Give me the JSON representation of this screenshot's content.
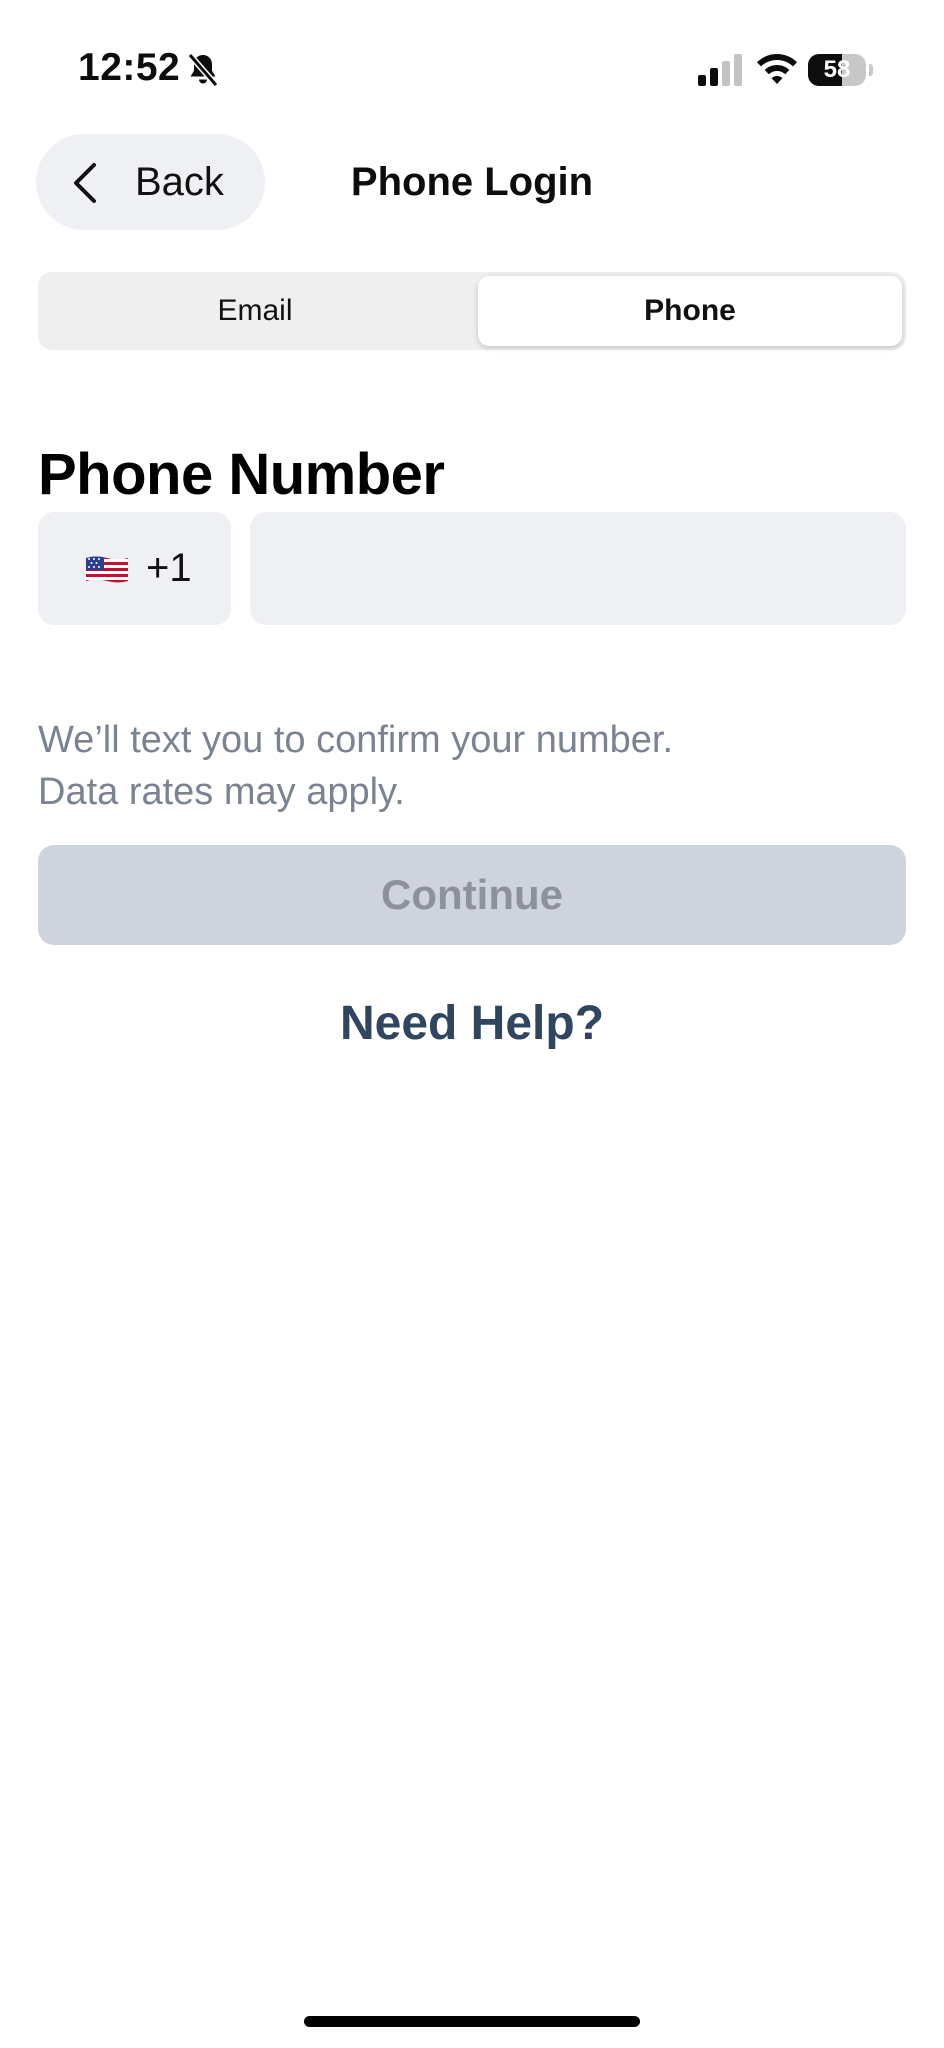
{
  "status_bar": {
    "time": "12:52",
    "battery_percent": "58",
    "battery_level": 0.58,
    "icons": [
      "bell-slash-icon",
      "cellular-signal-icon",
      "wifi-icon",
      "battery-icon"
    ]
  },
  "header": {
    "back_label": "Back",
    "title": "Phone Login"
  },
  "tabs": [
    {
      "label": "Email",
      "selected": false
    },
    {
      "label": "Phone",
      "selected": true
    }
  ],
  "phone_form": {
    "heading": "Phone Number",
    "country_flag": "us-flag-icon",
    "country_code": "+1",
    "phone_value": "",
    "helper_lines": [
      "We’ll text you to confirm your number.",
      "Data rates may apply."
    ],
    "continue_label": "Continue",
    "continue_enabled": false,
    "help_label": "Need Help?"
  },
  "colors": {
    "field_background": "#eef0f4",
    "disabled_button": "#cfd3de",
    "disabled_button_text": "#8d919a",
    "help_link": "#2f4560",
    "helper_text": "#7b8392"
  }
}
